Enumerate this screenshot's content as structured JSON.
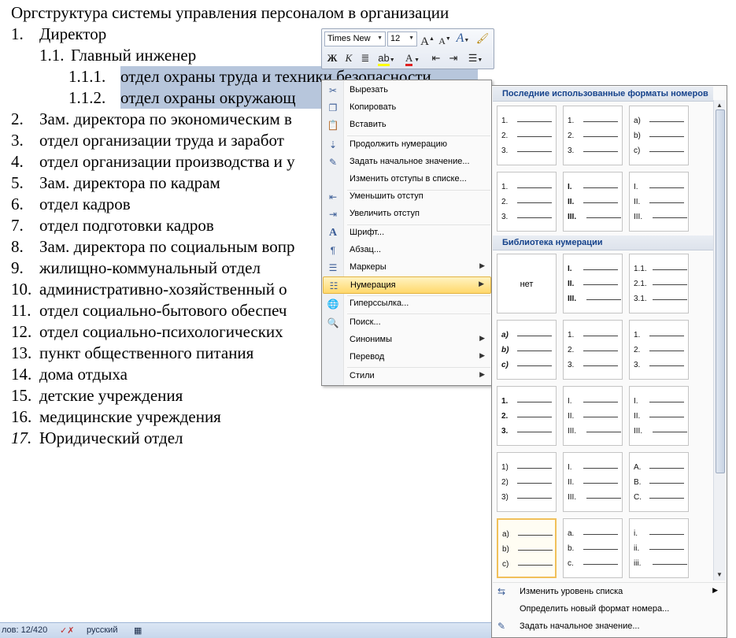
{
  "document": {
    "title": "Оргструктура системы управления персоналом в организации",
    "lines": [
      {
        "num": "1.",
        "text": "Директор"
      },
      {
        "num": "1.1.",
        "text": "Главный инженер"
      },
      {
        "num": "1.1.1.",
        "text": "отдел охраны труда и техники безопасности"
      },
      {
        "num": "1.1.2.",
        "text": "отдел охраны окружающ"
      },
      {
        "num": "2.",
        "text": "Зам. директора по экономическим в"
      },
      {
        "num": "3.",
        "text": "отдел организации труда и заработ"
      },
      {
        "num": "4.",
        "text": "отдел организации производства и у"
      },
      {
        "num": "5.",
        "text": "Зам. директора по кадрам"
      },
      {
        "num": "6.",
        "text": "отдел кадров"
      },
      {
        "num": "7.",
        "text": "отдел подготовки кадров"
      },
      {
        "num": "8.",
        "text": "Зам. директора по социальным вопр"
      },
      {
        "num": "9.",
        "text": "жилищно-коммунальный отдел"
      },
      {
        "num": "10.",
        "text": "административно-хозяйственный о"
      },
      {
        "num": "11.",
        "text": "отдел социально-бытового обеспеч"
      },
      {
        "num": "12.",
        "text": "отдел социально-психологических"
      },
      {
        "num": "13.",
        "text": "пункт общественного питания"
      },
      {
        "num": "14.",
        "text": "дома отдыха"
      },
      {
        "num": "15.",
        "text": "детские учреждения"
      },
      {
        "num": "16.",
        "text": "медицинские учреждения"
      },
      {
        "num": "17.",
        "text": "Юридический отдел"
      }
    ]
  },
  "mini_toolbar": {
    "font_name": "Times New",
    "font_size": "12",
    "grow_font": "A",
    "shrink_font": "A",
    "bold": "Ж",
    "italic": "К",
    "font_color": "A"
  },
  "context_menu": {
    "items": [
      {
        "label": "Вырезать",
        "icon": "scissors-icon",
        "glyph": "✂"
      },
      {
        "label": "Копировать",
        "icon": "copy-icon",
        "glyph": "❐"
      },
      {
        "label": "Вставить",
        "icon": "paste-icon",
        "glyph": "📋"
      },
      {
        "label": "Продолжить нумерацию",
        "icon": "continue-numbering-icon",
        "glyph": "⇣"
      },
      {
        "label": "Задать начальное значение...",
        "icon": "set-value-icon",
        "glyph": "✎"
      },
      {
        "label": "Изменить отступы в списке...",
        "icon": "",
        "glyph": ""
      },
      {
        "label": "Уменьшить отступ",
        "icon": "decrease-indent-icon",
        "glyph": "⇤"
      },
      {
        "label": "Увеличить отступ",
        "icon": "increase-indent-icon",
        "glyph": "⇥"
      },
      {
        "label": "Шрифт...",
        "icon": "font-icon",
        "glyph": "A"
      },
      {
        "label": "Абзац...",
        "icon": "paragraph-icon",
        "glyph": "¶"
      },
      {
        "label": "Маркеры",
        "icon": "bullets-icon",
        "glyph": "☰"
      },
      {
        "label": "Нумерация",
        "icon": "numbering-icon",
        "glyph": "☷"
      },
      {
        "label": "Гиперссылка...",
        "icon": "hyperlink-icon",
        "glyph": "🌐"
      },
      {
        "label": "Поиск...",
        "icon": "research-icon",
        "glyph": "🔍"
      },
      {
        "label": "Синонимы",
        "icon": "",
        "glyph": ""
      },
      {
        "label": "Перевод",
        "icon": "",
        "glyph": ""
      },
      {
        "label": "Стили",
        "icon": "",
        "glyph": ""
      }
    ]
  },
  "gallery": {
    "recent_header": "Последние использованные форматы номеров",
    "library_header": "Библиотека нумерации",
    "none_label": "нет",
    "recent": [
      [
        "1.",
        "2.",
        "3."
      ],
      [
        "1.",
        "2.",
        "3."
      ],
      [
        "a)",
        "b)",
        "c)"
      ],
      [
        "1.",
        "2.",
        "3."
      ],
      [
        "I.",
        "II.",
        "III."
      ],
      [
        "I.",
        "II.",
        "III."
      ]
    ],
    "library": [
      [
        "I.",
        "II.",
        "III."
      ],
      [
        "1.1.",
        "2.1.",
        "3.1."
      ],
      [
        "a)",
        "b)",
        "c)"
      ],
      [
        "1.",
        "2.",
        "3."
      ],
      [
        "1.",
        "2.",
        "3."
      ],
      [
        "1.",
        "2.",
        "3."
      ],
      [
        "I.",
        "II.",
        "III."
      ],
      [
        "I.",
        "II.",
        "III."
      ],
      [
        "1)",
        "2)",
        "3)"
      ],
      [
        "I.",
        "II.",
        "III."
      ],
      [
        "A.",
        "B.",
        "C."
      ],
      [
        "a)",
        "b)",
        "c)"
      ],
      [
        "a.",
        "b.",
        "c."
      ],
      [
        "i.",
        "ii.",
        "iii."
      ]
    ],
    "footer": {
      "change_level": "Изменить уровень списка",
      "define_new": "Определить новый формат номера...",
      "set_value": "Задать начальное значение..."
    }
  },
  "status_bar": {
    "words": "лов: 12/420",
    "language": "русский"
  }
}
